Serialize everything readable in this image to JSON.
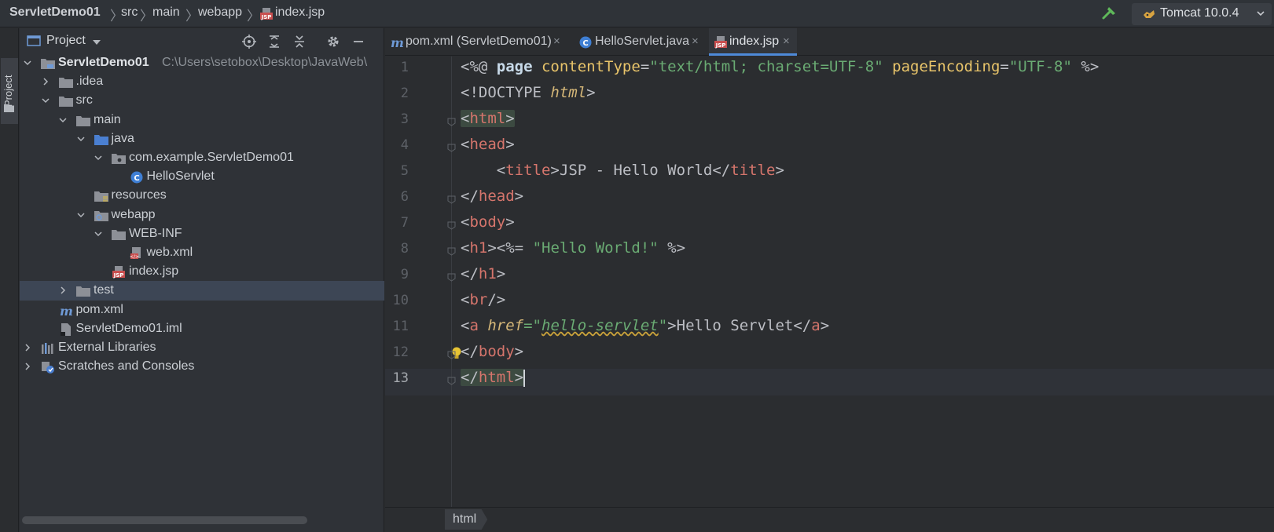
{
  "navbar": {
    "crumbs": [
      "ServletDemo01",
      "src",
      "main",
      "webapp",
      "index.jsp"
    ],
    "run_config": "Tomcat 10.0.4"
  },
  "tool_stripe": {
    "label": "Project"
  },
  "project_panel": {
    "title": "Project",
    "tree": [
      {
        "label": "ServletDemo01",
        "path": "C:\\Users\\setobox\\Desktop\\JavaWeb\\",
        "depth": 0,
        "icon": "module-folder-icon",
        "expanded": true
      },
      {
        "label": ".idea",
        "depth": 1,
        "icon": "folder-icon",
        "expanded": false
      },
      {
        "label": "src",
        "depth": 1,
        "icon": "folder-icon",
        "expanded": true
      },
      {
        "label": "main",
        "depth": 2,
        "icon": "folder-icon",
        "expanded": true
      },
      {
        "label": "java",
        "depth": 3,
        "icon": "source-folder-icon",
        "expanded": true
      },
      {
        "label": "com.example.ServletDemo01",
        "depth": 4,
        "icon": "package-icon",
        "expanded": true
      },
      {
        "label": "HelloServlet",
        "depth": 5,
        "icon": "java-class-icon"
      },
      {
        "label": "resources",
        "depth": 3,
        "icon": "resources-folder-icon"
      },
      {
        "label": "webapp",
        "depth": 3,
        "icon": "web-folder-icon",
        "expanded": true
      },
      {
        "label": "WEB-INF",
        "depth": 4,
        "icon": "folder-icon",
        "expanded": true
      },
      {
        "label": "web.xml",
        "depth": 5,
        "icon": "xml-file-icon"
      },
      {
        "label": "index.jsp",
        "depth": 4,
        "icon": "jsp-file-icon"
      },
      {
        "label": "test",
        "depth": 2,
        "icon": "folder-icon",
        "expanded": false,
        "selected": true
      },
      {
        "label": "pom.xml",
        "depth": 1,
        "icon": "maven-icon"
      },
      {
        "label": "ServletDemo01.iml",
        "depth": 1,
        "icon": "iml-file-icon"
      },
      {
        "label": "External Libraries",
        "depth": 0,
        "icon": "libraries-icon",
        "expanded": false
      },
      {
        "label": "Scratches and Consoles",
        "depth": 0,
        "icon": "scratches-icon",
        "expanded": false
      }
    ]
  },
  "tabs": [
    {
      "label": "pom.xml (ServletDemo01)",
      "icon": "maven-icon",
      "close": "×"
    },
    {
      "label": "HelloServlet.java",
      "icon": "java-class-icon",
      "close": "×"
    },
    {
      "label": "index.jsp",
      "icon": "jsp-file-icon",
      "close": "×",
      "active": true
    }
  ],
  "editor": {
    "line_numbers": [
      "1",
      "2",
      "3",
      "4",
      "5",
      "6",
      "7",
      "8",
      "9",
      "10",
      "11",
      "12",
      "13"
    ],
    "code": {
      "l1_open": "<%@ ",
      "l1_page": "page",
      "l1_ct_attr": " contentType",
      "l1_eq1": "=",
      "l1_ct_val": "\"text/html; charset=UTF-8\"",
      "l1_pe_attr": " pageEncoding",
      "l1_eq2": "=",
      "l1_pe_val": "\"UTF-8\"",
      "l1_close": " %>",
      "l2_doctype": "<!DOCTYPE ",
      "l2_html": "html",
      "l2_close": ">",
      "l3_lt": "<",
      "l3_tag": "html",
      "l3_gt": ">",
      "l4_lt": "<",
      "l4_tag": "head",
      "l4_gt": ">",
      "l5_indent": "    ",
      "l5_lt": "<",
      "l5_tag": "title",
      "l5_gt": ">",
      "l5_text": "JSP - Hello World",
      "l5_lt2": "</",
      "l5_tag2": "title",
      "l5_gt2": ">",
      "l6_lt": "</",
      "l6_tag": "head",
      "l6_gt": ">",
      "l7_lt": "<",
      "l7_tag": "body",
      "l7_gt": ">",
      "l8_lt": "<",
      "l8_tag": "h1",
      "l8_gt": ">",
      "l8_expr_open": "<%= ",
      "l8_str": "\"Hello World!\"",
      "l8_expr_close": " %>",
      "l9_lt": "</",
      "l9_tag": "h1",
      "l9_gt": ">",
      "l10_lt": "<",
      "l10_tag": "br",
      "l10_gt": "/>",
      "l11_lt": "<",
      "l11_tag": "a",
      "l11_attr": " href",
      "l11_eq": "=\"",
      "l11_url": "hello-servlet",
      "l11_q": "\"",
      "l11_gt": ">",
      "l11_text": "Hello Servlet",
      "l11_lt2": "</",
      "l11_tag2": "a",
      "l11_gt2": ">",
      "l12_lt": "</",
      "l12_tag": "body",
      "l12_gt": ">",
      "l13_lt": "</",
      "l13_tag": "html",
      "l13_gt": ">"
    }
  },
  "breadcrumb_bar": {
    "tag": "html"
  },
  "colors": {
    "accent": "#4e8ad9",
    "tag": "#d5756c",
    "string": "#6aab73",
    "selection": "#3d4655"
  }
}
